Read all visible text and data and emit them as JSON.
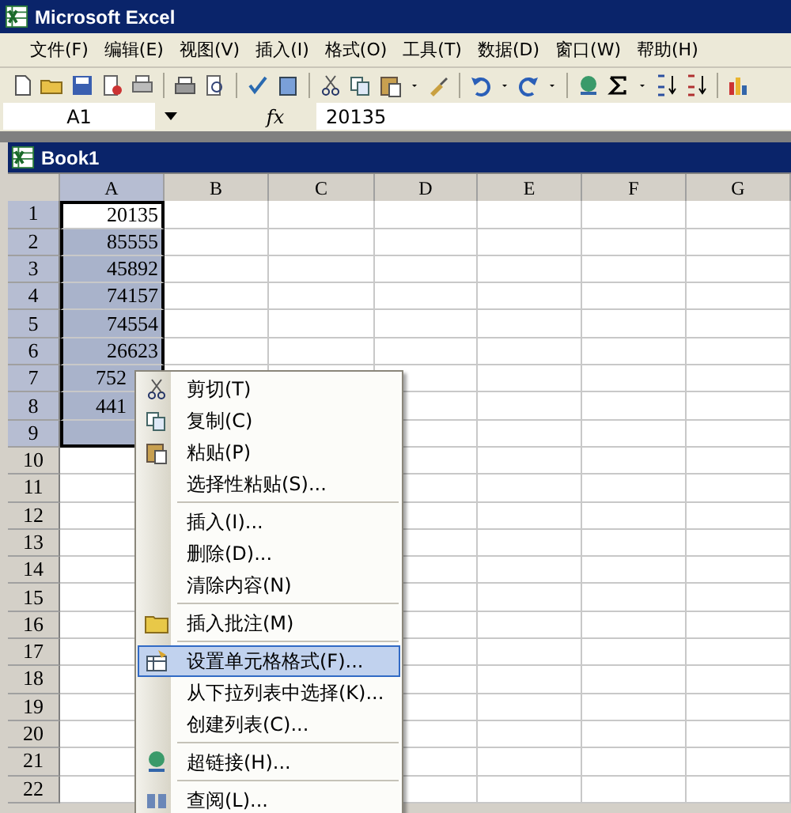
{
  "window": {
    "title": "Microsoft Excel"
  },
  "menu_bar": [
    {
      "label": "文件(F)"
    },
    {
      "label": "编辑(E)"
    },
    {
      "label": "视图(V)"
    },
    {
      "label": "插入(I)"
    },
    {
      "label": "格式(O)"
    },
    {
      "label": "工具(T)"
    },
    {
      "label": "数据(D)"
    },
    {
      "label": "窗口(W)"
    },
    {
      "label": "帮助(H)"
    }
  ],
  "formula_bar": {
    "name_box": "A1",
    "function_label": "fx",
    "value": "20135"
  },
  "workbook": {
    "title": "Book1"
  },
  "sheet": {
    "columns": [
      {
        "label": "A",
        "selected": true
      },
      {
        "label": "B",
        "selected": false
      },
      {
        "label": "C",
        "selected": false
      },
      {
        "label": "D",
        "selected": false
      },
      {
        "label": "E",
        "selected": false
      },
      {
        "label": "F",
        "selected": false
      },
      {
        "label": "G",
        "selected": false
      }
    ],
    "rows": [
      {
        "label": "1",
        "selected": true,
        "active": true,
        "value": "20135"
      },
      {
        "label": "2",
        "selected": true,
        "active": false,
        "value": "85555"
      },
      {
        "label": "3",
        "selected": true,
        "active": false,
        "value": "45892"
      },
      {
        "label": "4",
        "selected": true,
        "active": false,
        "value": "74157"
      },
      {
        "label": "5",
        "selected": true,
        "active": false,
        "value": "74554"
      },
      {
        "label": "6",
        "selected": true,
        "active": false,
        "value": "26623"
      },
      {
        "label": "7",
        "selected": true,
        "active": false,
        "value": "752",
        "covered": true
      },
      {
        "label": "8",
        "selected": true,
        "active": false,
        "value": "441",
        "covered": true
      },
      {
        "label": "9",
        "selected": true,
        "active": false
      },
      {
        "label": "10",
        "selected": false,
        "active": false
      },
      {
        "label": "11",
        "selected": false,
        "active": false
      },
      {
        "label": "12",
        "selected": false,
        "active": false
      },
      {
        "label": "13",
        "selected": false,
        "active": false
      },
      {
        "label": "14",
        "selected": false,
        "active": false
      },
      {
        "label": "15",
        "selected": false,
        "active": false
      },
      {
        "label": "16",
        "selected": false,
        "active": false
      },
      {
        "label": "17",
        "selected": false,
        "active": false
      },
      {
        "label": "18",
        "selected": false,
        "active": false
      },
      {
        "label": "19",
        "selected": false,
        "active": false
      },
      {
        "label": "20",
        "selected": false,
        "active": false
      },
      {
        "label": "21",
        "selected": false,
        "active": false
      },
      {
        "label": "22",
        "selected": false,
        "active": false
      }
    ]
  },
  "context_menu": [
    {
      "label": "剪切(T)",
      "separator_before": false,
      "selected": false
    },
    {
      "label": "复制(C)",
      "separator_before": false,
      "selected": false
    },
    {
      "label": "粘贴(P)",
      "separator_before": false,
      "selected": false
    },
    {
      "label": "选择性粘贴(S)...",
      "separator_before": false,
      "selected": false
    },
    {
      "label": "插入(I)...",
      "separator_before": true,
      "selected": false
    },
    {
      "label": "删除(D)...",
      "separator_before": false,
      "selected": false
    },
    {
      "label": "清除内容(N)",
      "separator_before": false,
      "selected": false
    },
    {
      "label": "插入批注(M)",
      "separator_before": true,
      "selected": false
    },
    {
      "label": "设置单元格格式(F)...",
      "separator_before": true,
      "selected": true
    },
    {
      "label": "从下拉列表中选择(K)...",
      "separator_before": false,
      "selected": false
    },
    {
      "label": "创建列表(C)...",
      "separator_before": false,
      "selected": false
    },
    {
      "label": "超链接(H)...",
      "separator_before": true,
      "selected": false
    },
    {
      "label": "查阅(L)...",
      "separator_before": true,
      "selected": false
    }
  ]
}
